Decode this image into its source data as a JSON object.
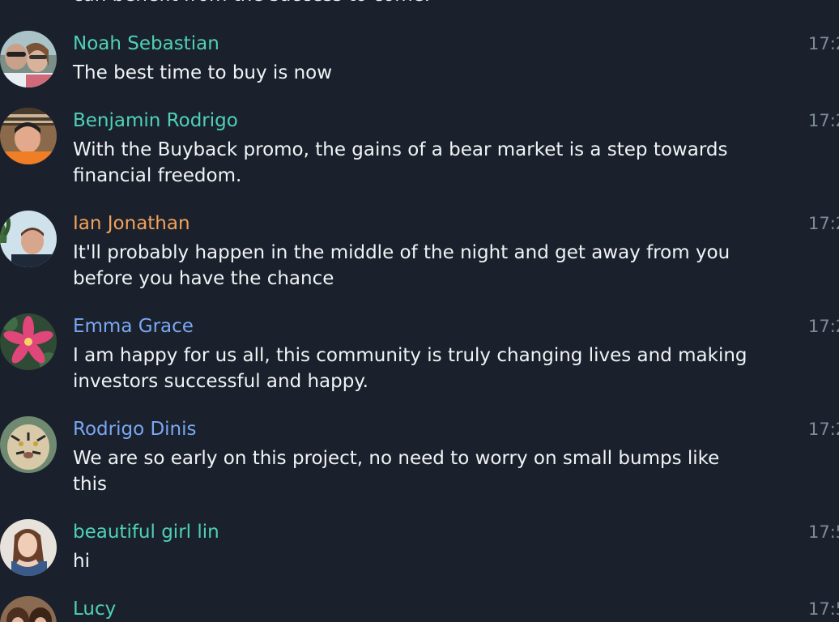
{
  "chat": {
    "previous_line": "can benefit from the success to come.",
    "messages": [
      {
        "sender": "Noah Sebastian",
        "text": "The best time to buy is now",
        "time": "17:2",
        "name_color": "#4fd1b5"
      },
      {
        "sender": "Benjamin Rodrigo",
        "text": "With the Buyback promo, the gains of a bear market is a step towards\nfinancial freedom.",
        "time": "17:2",
        "name_color": "#4fd1b5"
      },
      {
        "sender": "Ian Jonathan",
        "text": "It'll probably happen in the middle of the night and get away from you\nbefore you have the chance",
        "time": "17:2",
        "name_color": "#f3a15b"
      },
      {
        "sender": "Emma Grace",
        "text": "I am happy for us all, this community is truly changing lives and making\ninvestors successful and happy.",
        "time": "17:2",
        "name_color": "#7aa7f3"
      },
      {
        "sender": "Rodrigo Dinis",
        "text": "We are so early on this project, no need to worry on small bumps like\nthis",
        "time": "17:2",
        "name_color": "#7aa7f3"
      },
      {
        "sender": "beautiful girl lin",
        "text": "hi",
        "time": "17:5",
        "name_color": "#4fd1b5"
      },
      {
        "sender": "Lucy",
        "text": "",
        "time": "17:5",
        "name_color": "#4fd1b5"
      }
    ]
  }
}
